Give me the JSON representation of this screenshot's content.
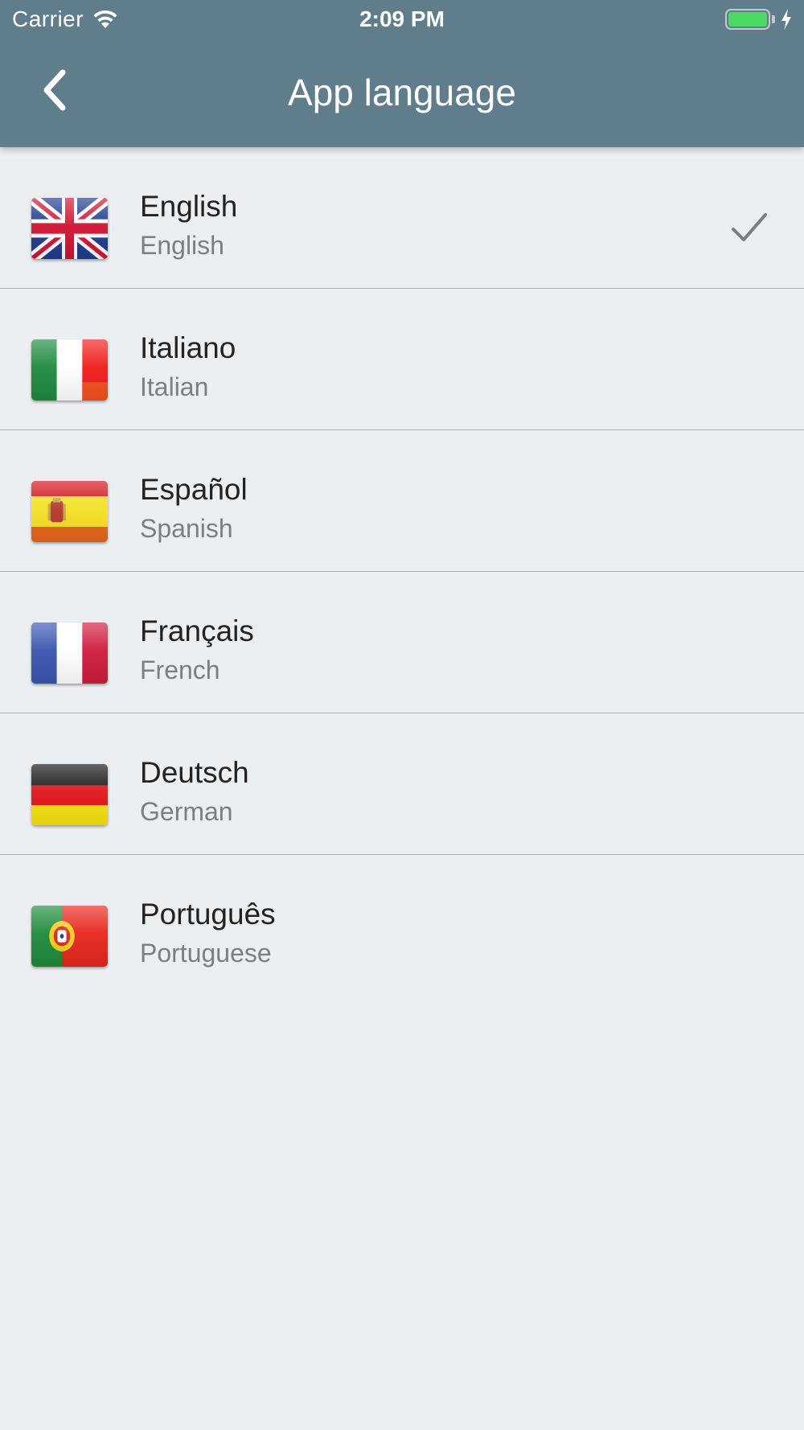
{
  "status_bar": {
    "carrier": "Carrier",
    "time": "2:09 PM",
    "wifi_icon": "wifi-icon",
    "battery_icon": "battery-charging-icon",
    "battery_color": "#4cd964"
  },
  "header": {
    "title": "App language",
    "back_icon": "chevron-left-icon",
    "background_color": "#607d8b"
  },
  "languages": [
    {
      "native": "English",
      "english": "English",
      "flag_icon": "flag-uk-icon",
      "selected": true
    },
    {
      "native": "Italiano",
      "english": "Italian",
      "flag_icon": "flag-italy-icon",
      "selected": false
    },
    {
      "native": "Español",
      "english": "Spanish",
      "flag_icon": "flag-spain-icon",
      "selected": false
    },
    {
      "native": "Français",
      "english": "French",
      "flag_icon": "flag-france-icon",
      "selected": false
    },
    {
      "native": "Deutsch",
      "english": "German",
      "flag_icon": "flag-germany-icon",
      "selected": false
    },
    {
      "native": "Português",
      "english": "Portuguese",
      "flag_icon": "flag-portugal-icon",
      "selected": false
    }
  ],
  "selected_check_icon": "checkmark-icon"
}
